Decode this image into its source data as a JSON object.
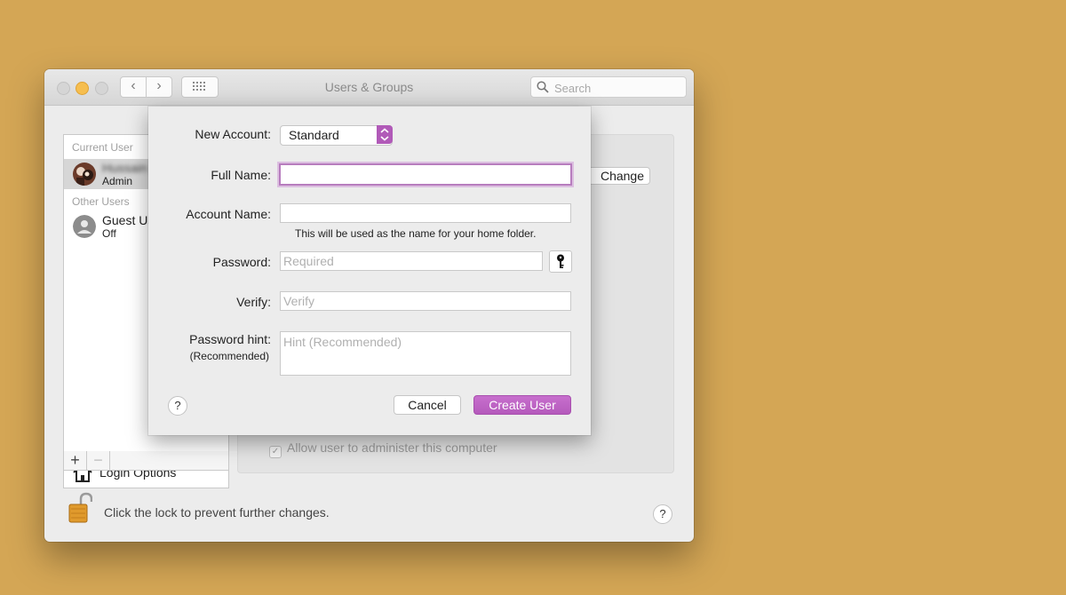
{
  "window": {
    "title": "Users & Groups",
    "search_placeholder": "Search",
    "nav_back": "‹",
    "nav_forward": "›"
  },
  "sidebar": {
    "current_user_header": "Current User",
    "current_user": {
      "name": "Hussain",
      "role": "Admin"
    },
    "other_users_header": "Other Users",
    "other_users": [
      {
        "name": "Guest User",
        "status": "Off"
      }
    ],
    "login_options": "Login Options",
    "add_label": "+",
    "remove_label": "−"
  },
  "main_pane": {
    "change_password_label": "Change Password...",
    "admin_checkbox_label": "Allow user to administer this computer",
    "admin_checkbox_mark": "✓"
  },
  "footer": {
    "lock_text": "Click the lock to prevent further changes.",
    "help": "?"
  },
  "sheet": {
    "new_account_label": "New Account:",
    "account_type": "Standard",
    "full_name_label": "Full Name:",
    "full_name_value": "",
    "account_name_label": "Account Name:",
    "account_name_value": "",
    "account_name_note": "This will be used as the name for your home folder.",
    "password_label": "Password:",
    "password_placeholder": "Required",
    "verify_label": "Verify:",
    "verify_placeholder": "Verify",
    "hint_label": "Password hint:",
    "hint_sublabel": "(Recommended)",
    "hint_placeholder": "Hint (Recommended)",
    "help": "?",
    "cancel_label": "Cancel",
    "create_label": "Create User"
  },
  "colors": {
    "desktop": "#d4a655",
    "accent": "#b55abc"
  }
}
